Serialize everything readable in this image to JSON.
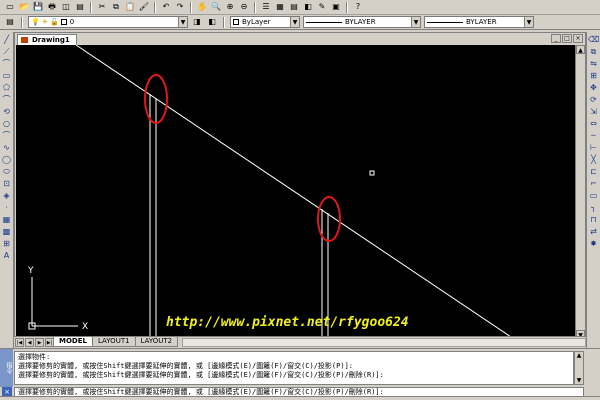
{
  "toolbar_top": {
    "icons": [
      "new-icon",
      "open-icon",
      "save-icon",
      "print-icon",
      "plot-preview-icon",
      "publish-icon",
      "cut-icon",
      "copy-icon",
      "paste-icon",
      "match-properties-icon",
      "undo-icon",
      "redo-icon",
      "pan-icon",
      "zoom-realtime-icon",
      "zoom-window-icon",
      "zoom-previous-icon",
      "properties-icon",
      "design-center-icon",
      "tool-palettes-icon",
      "sheet-set-icon",
      "markup-icon",
      "calculator-icon",
      "help-icon"
    ],
    "glyphs": [
      "▭",
      "📂",
      "💾",
      "🖶",
      "◫",
      "▤",
      "✂",
      "⧉",
      "📋",
      "🖌",
      "↶",
      "↷",
      "✋",
      "🔍",
      "⊕",
      "⊖",
      "☰",
      "▦",
      "▤",
      "◧",
      "✎",
      "▣",
      "?"
    ]
  },
  "layer_toolbar": {
    "layer_value": "0",
    "color_value": "ByLayer",
    "linetype_value": "BYLAYER",
    "lineweight_value": "BYLAYER"
  },
  "document": {
    "tab_label": "Drawing1"
  },
  "left_toolbar_glyphs": [
    "╱",
    "⟋",
    "⌒",
    "▭",
    "⬠",
    "⌒",
    "⟲",
    "○",
    "⌒",
    "∿",
    "◯",
    "⬭",
    "⊡",
    "◈",
    "·",
    "▦",
    "▩",
    "⊞",
    "A"
  ],
  "right_toolbar_glyphs": [
    "⌫",
    "⧉",
    "⇋",
    "⊞",
    "✥",
    "⟳",
    "⇲",
    "⇔",
    "╌",
    "⊢",
    "╳",
    "⊏",
    "⌐",
    "▭",
    "╮",
    "⊓",
    "⇄",
    "✸"
  ],
  "layout_tabs": [
    "MODEL",
    "LAYOUT1",
    "LAYOUT2"
  ],
  "watermark_text": "http://www.pixnet.net/rfygoo624",
  "command": {
    "history": [
      "選擇物件:",
      "選擇要修剪的實體, 或按住Shift鍵選擇要延伸的實體, 或 [邊緣模式(E)/圍籬(F)/窗交(C)/投影(P)]:",
      "選擇要修剪的實體, 或按住Shift鍵選擇要延伸的實體, 或 [邊緣模式(E)/圍籬(F)/窗交(C)/投影(P)/刪除(R)]:"
    ],
    "current_line": "選擇要修剪的實體, 或按住Shift鍵選擇要延伸的實體, 或 [邊緣模式(E)/圍籬(F)/窗交(C)/投影(P)/刪除(R)]:"
  },
  "ucs": {
    "x_label": "X",
    "y_label": "Y"
  },
  "colors": {
    "canvas": "#000000",
    "geometry": "#ffffff",
    "highlight_circle": "#e01818",
    "watermark": "#f0f020"
  }
}
